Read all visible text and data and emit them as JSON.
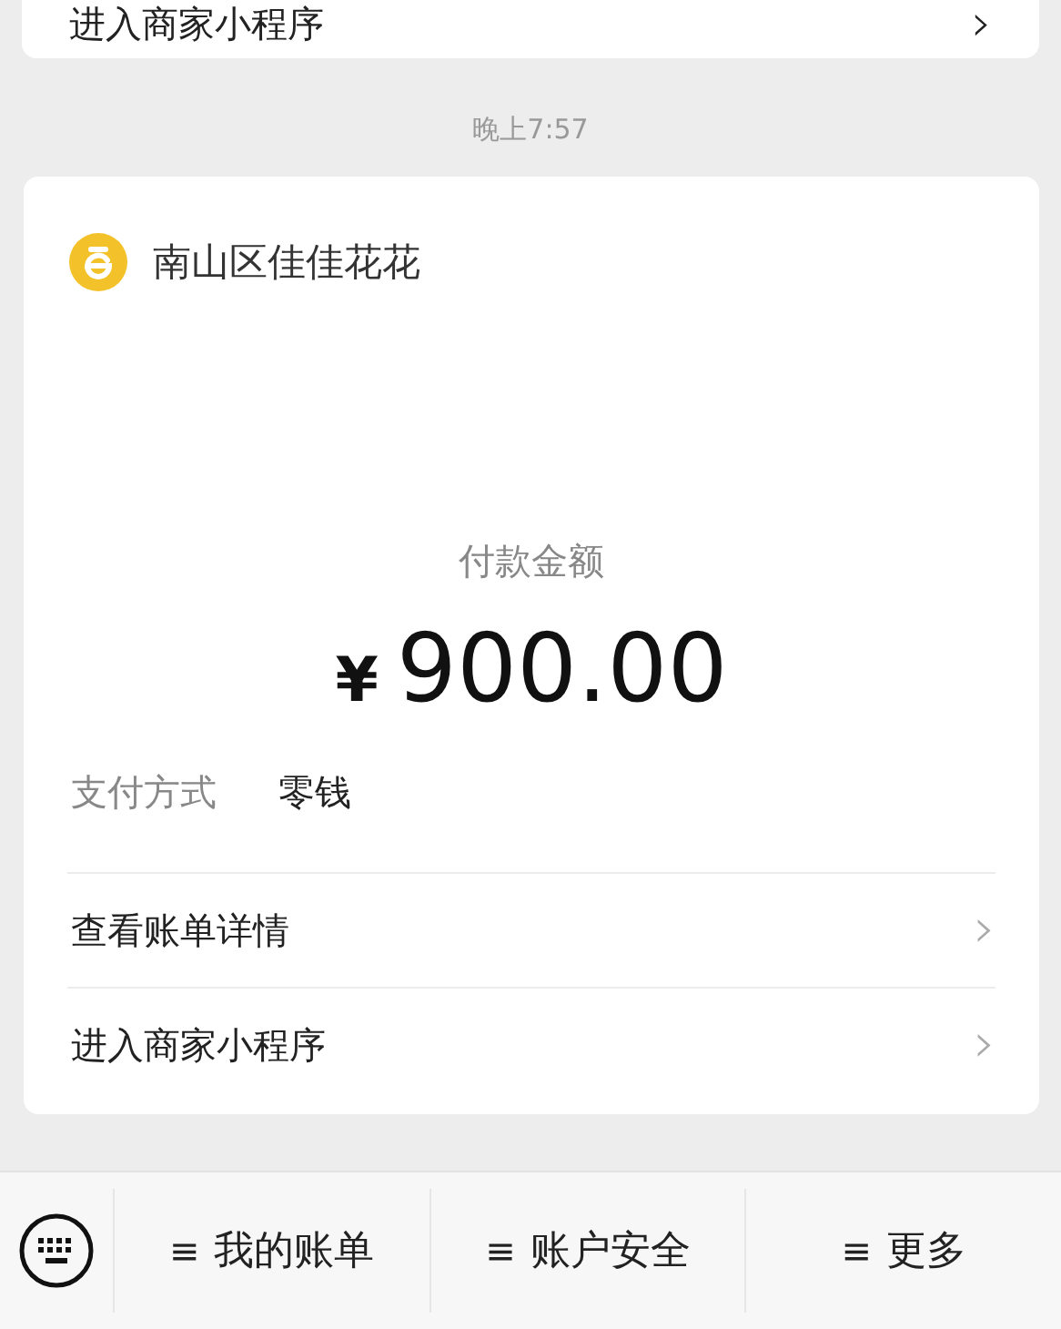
{
  "previous_card": {
    "link": "进入商家小程序",
    "chevron": "›"
  },
  "timestamp": "晚上7:57",
  "payment_card": {
    "merchant": "南山区佳佳花花",
    "amount_label": "付款金额",
    "currency": "¥",
    "amount": "900.00",
    "method_label": "支付方式",
    "method_value": "零钱",
    "links": [
      {
        "label": "查看账单详情",
        "chevron": "›"
      },
      {
        "label": "进入商家小程序",
        "chevron": "›"
      }
    ]
  },
  "bottom_menu": [
    {
      "icon": "≡",
      "label": "我的账单"
    },
    {
      "icon": "≡",
      "label": "账户安全"
    },
    {
      "icon": "≡",
      "label": "更多"
    }
  ]
}
